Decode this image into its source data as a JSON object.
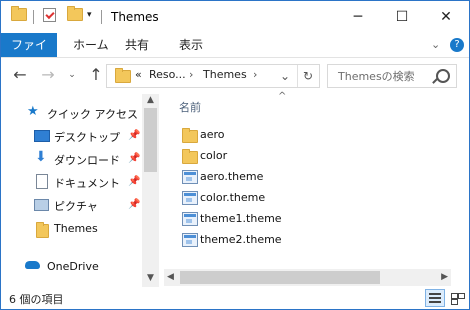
{
  "window": {
    "title": "Themes",
    "controls": {
      "minimize": "─",
      "maximize": "☐",
      "close": "✕"
    }
  },
  "ribbon": {
    "tabs": [
      "ファイル",
      "ホーム",
      "共有",
      "表示"
    ],
    "expand_icon": "chevron-down-icon",
    "help_label": "?"
  },
  "address": {
    "path_prefix": "«",
    "crumbs": [
      "Reso...",
      "Themes"
    ],
    "search_placeholder": "Themesの検索"
  },
  "sidebar": {
    "items": [
      {
        "label": "クイック アクセス",
        "icon": "star-icon"
      },
      {
        "label": "デスクトップ",
        "icon": "desktop-icon",
        "pinned": true
      },
      {
        "label": "ダウンロード",
        "icon": "download-icon",
        "pinned": true
      },
      {
        "label": "ドキュメント",
        "icon": "document-icon",
        "pinned": true
      },
      {
        "label": "ピクチャ",
        "icon": "pictures-icon",
        "pinned": true
      },
      {
        "label": "Themes",
        "icon": "folder-icon"
      },
      {
        "label": "OneDrive",
        "icon": "cloud-icon"
      }
    ]
  },
  "main": {
    "column_name": "名前",
    "files": [
      {
        "name": "aero",
        "type": "folder"
      },
      {
        "name": "color",
        "type": "folder"
      },
      {
        "name": "aero.theme",
        "type": "theme"
      },
      {
        "name": "color.theme",
        "type": "theme"
      },
      {
        "name": "theme1.theme",
        "type": "theme"
      },
      {
        "name": "theme2.theme",
        "type": "theme"
      }
    ]
  },
  "status": {
    "item_count": "6 個の項目"
  },
  "colors": {
    "accent": "#1979ca",
    "folder": "#f3c75b"
  }
}
